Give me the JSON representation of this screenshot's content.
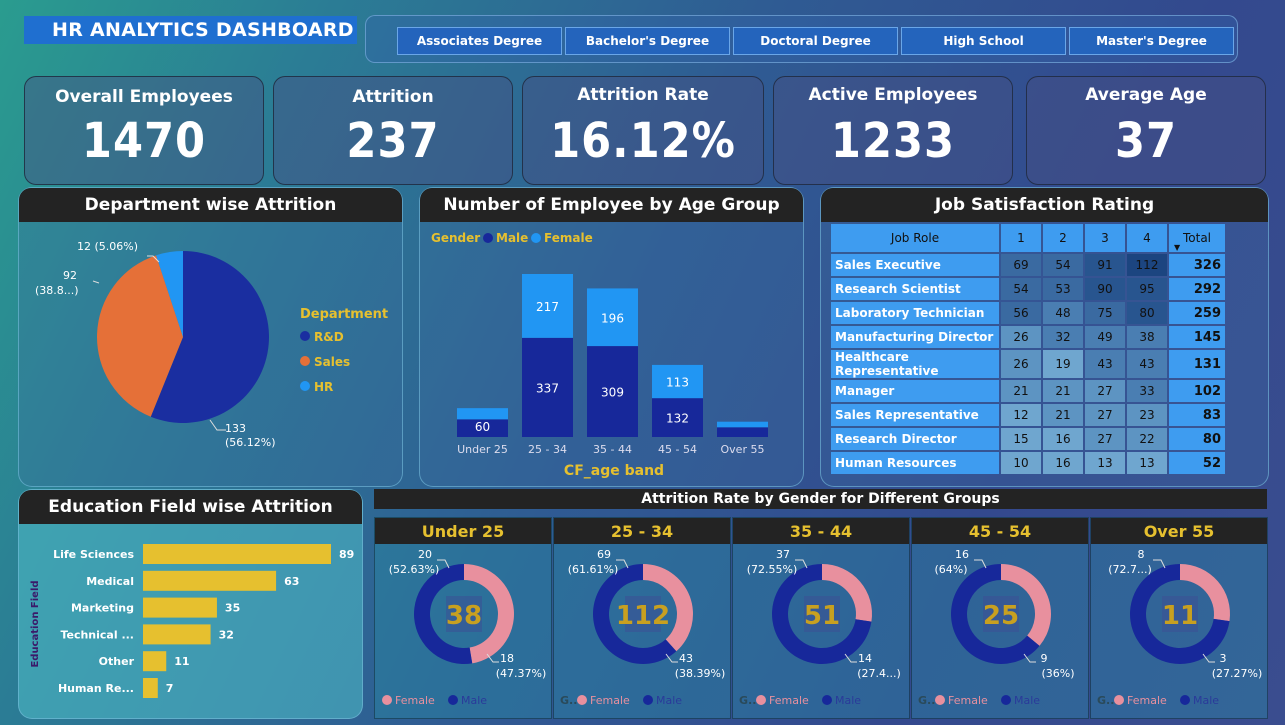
{
  "title": "HR ANALYTICS DASHBOARD",
  "slicer": [
    "Associates Degree",
    "Bachelor's Degree",
    "Doctoral Degree",
    "High School",
    "Master's Degree"
  ],
  "kpis": [
    {
      "label": "Overall Employees",
      "value": "1470"
    },
    {
      "label": "Attrition",
      "value": "237"
    },
    {
      "label": "Attrition Rate",
      "value": "16.12%"
    },
    {
      "label": "Active Employees",
      "value": "1233"
    },
    {
      "label": "Average Age",
      "value": "37"
    }
  ],
  "colors": {
    "rd": "#1a2ea0",
    "sales": "#e57038",
    "hr": "#2196f3",
    "male": "#17289a",
    "female": "#2196f3",
    "gold": "#e6c02f",
    "pink": "#e8909e"
  },
  "chart_data": [
    {
      "type": "pie",
      "title": "Department wise Attrition",
      "legend_title": "Department",
      "legend": [
        "R&D",
        "Sales",
        "HR"
      ],
      "values": [
        133,
        92,
        12
      ],
      "labels": [
        {
          "a": "133",
          "b": "(56.12%)"
        },
        {
          "a": "92",
          "b": "(38.8...)"
        },
        {
          "a": "12 (5.06%)",
          "b": ""
        }
      ]
    },
    {
      "type": "bar",
      "title": "Number of Employee by Age Group",
      "xlabel": "CF_age band",
      "legend_title": "Gender",
      "categories": [
        "Under 25",
        "25 - 34",
        "35 - 44",
        "45 - 54",
        "Over 55"
      ],
      "series": [
        {
          "name": "Male",
          "values": [
            60,
            337,
            309,
            132,
            33
          ]
        },
        {
          "name": "Female",
          "values": [
            38,
            217,
            196,
            113,
            19
          ]
        }
      ],
      "labels": {
        "Male": [
          "60",
          "337",
          "309",
          "132",
          ""
        ],
        "Female": [
          "",
          "217",
          "196",
          "113",
          ""
        ]
      }
    },
    {
      "type": "table",
      "title": "Job Satisfaction Rating",
      "columns": [
        "Job Role",
        "1",
        "2",
        "3",
        "4",
        "Total"
      ],
      "rows": [
        [
          "Sales Executive",
          "69",
          "54",
          "91",
          "112",
          "326"
        ],
        [
          "Research Scientist",
          "54",
          "53",
          "90",
          "95",
          "292"
        ],
        [
          "Laboratory Technician",
          "56",
          "48",
          "75",
          "80",
          "259"
        ],
        [
          "Manufacturing Director",
          "26",
          "32",
          "49",
          "38",
          "145"
        ],
        [
          "Healthcare Representative",
          "26",
          "19",
          "43",
          "43",
          "131"
        ],
        [
          "Manager",
          "21",
          "21",
          "27",
          "33",
          "102"
        ],
        [
          "Sales Representative",
          "12",
          "21",
          "27",
          "23",
          "83"
        ],
        [
          "Research Director",
          "15",
          "16",
          "27",
          "22",
          "80"
        ],
        [
          "Human Resources",
          "10",
          "16",
          "13",
          "13",
          "52"
        ]
      ]
    },
    {
      "type": "bar",
      "title": "Education Field wise Attrition",
      "ylabel": "Education Field",
      "categories": [
        "Life Sciences",
        "Medical",
        "Marketing",
        "Technical ...",
        "Other",
        "Human Re..."
      ],
      "values": [
        89,
        63,
        35,
        32,
        11,
        7
      ]
    },
    {
      "type": "pie",
      "title": "Attrition Rate by Gender for Different Groups",
      "groups": [
        {
          "name": "Under 25",
          "total": "38",
          "female": 18,
          "male": 20,
          "female_label": [
            "18",
            "(47.37%)"
          ],
          "male_label": [
            "20",
            "(52.63%)"
          ],
          "legend_prefix": ""
        },
        {
          "name": "25 - 34",
          "total": "112",
          "female": 43,
          "male": 69,
          "female_label": [
            "43",
            "(38.39%)"
          ],
          "male_label": [
            "69",
            "(61.61%)"
          ],
          "legend_prefix": "G..."
        },
        {
          "name": "35 - 44",
          "total": "51",
          "female": 14,
          "male": 37,
          "female_label": [
            "14",
            "(27.4...)"
          ],
          "male_label": [
            "37",
            "(72.55%)"
          ],
          "legend_prefix": "G..."
        },
        {
          "name": "45 - 54",
          "total": "25",
          "female": 9,
          "male": 16,
          "female_label": [
            "9",
            "(36%)"
          ],
          "male_label": [
            "16",
            "(64%)"
          ],
          "legend_prefix": "G..."
        },
        {
          "name": "Over 55",
          "total": "11",
          "female": 3,
          "male": 8,
          "female_label": [
            "3",
            "(27.27%)"
          ],
          "male_label": [
            "8",
            "(72.7...)"
          ],
          "legend_prefix": "G..."
        }
      ],
      "legend": [
        "Female",
        "Male"
      ]
    }
  ]
}
